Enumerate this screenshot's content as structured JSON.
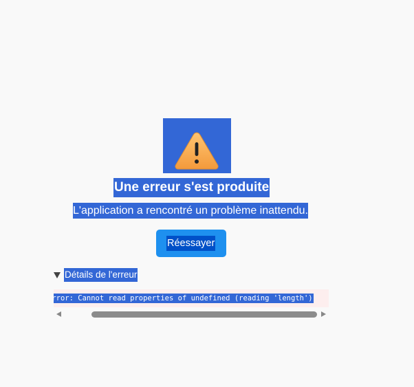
{
  "error_page": {
    "icon": "warning-icon",
    "title": "Une erreur s'est produite",
    "subtitle": "L'application a rencontré un problème inattendu.",
    "retry_label": "Réessayer",
    "details_label": "Détails de l'erreur",
    "error_message": "Error: Cannot read properties of undefined (reading 'length')"
  },
  "colors": {
    "background": "#f9f9f9",
    "selection": "#3367d6",
    "button": "#1e90ef",
    "warning": "#f6a94a",
    "error_bg": "#fdeeee"
  }
}
